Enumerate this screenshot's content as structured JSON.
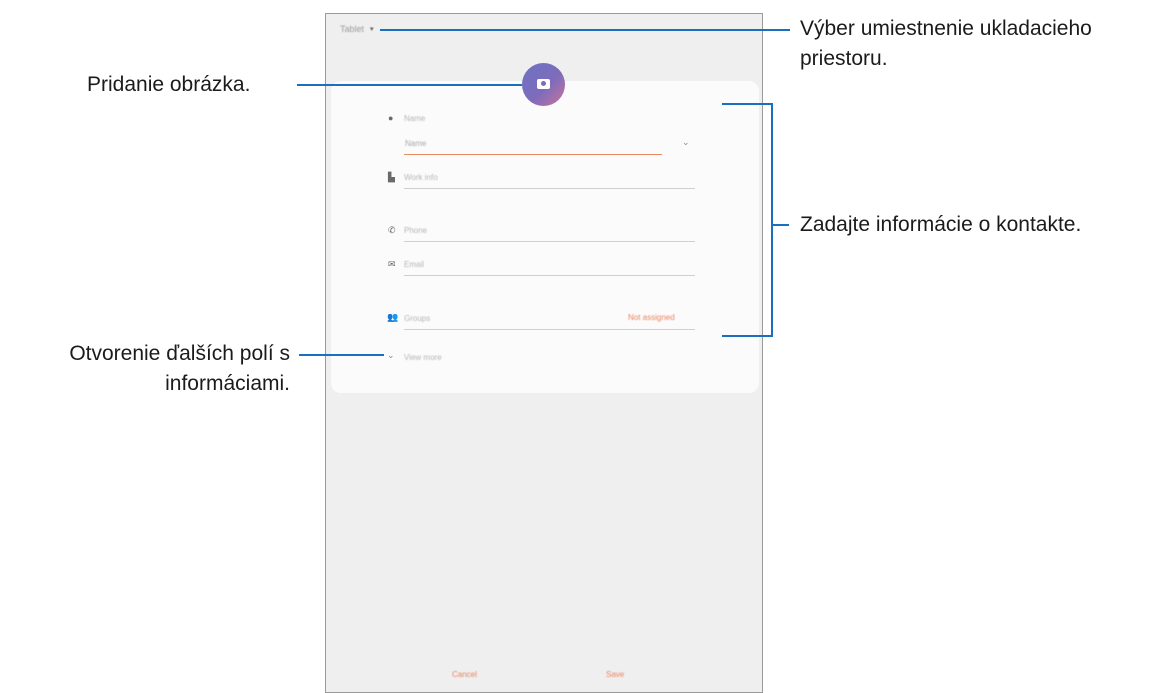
{
  "storage": {
    "label": "Tablet",
    "caret": "▾"
  },
  "form": {
    "name_section_label": "Name",
    "name_placeholder": "Name",
    "work_info_placeholder": "Work info",
    "phone_placeholder": "Phone",
    "email_placeholder": "Email",
    "groups_placeholder": "Groups",
    "groups_value": "Not assigned",
    "view_more_label": "View more"
  },
  "buttons": {
    "cancel": "Cancel",
    "save": "Save"
  },
  "callouts": {
    "storage_line1": "Výber umiestnenie ukladacieho",
    "storage_line2": "priestoru.",
    "add_image": "Pridanie obrázka.",
    "enter_info": "Zadajte informácie o kontakte.",
    "more_fields_line1": "Otvorenie ďalších polí s",
    "more_fields_line2": "informáciami."
  },
  "colors": {
    "accent": "#e9845f",
    "leader": "#1a6fbf",
    "avatar": "#7d6cbb"
  }
}
